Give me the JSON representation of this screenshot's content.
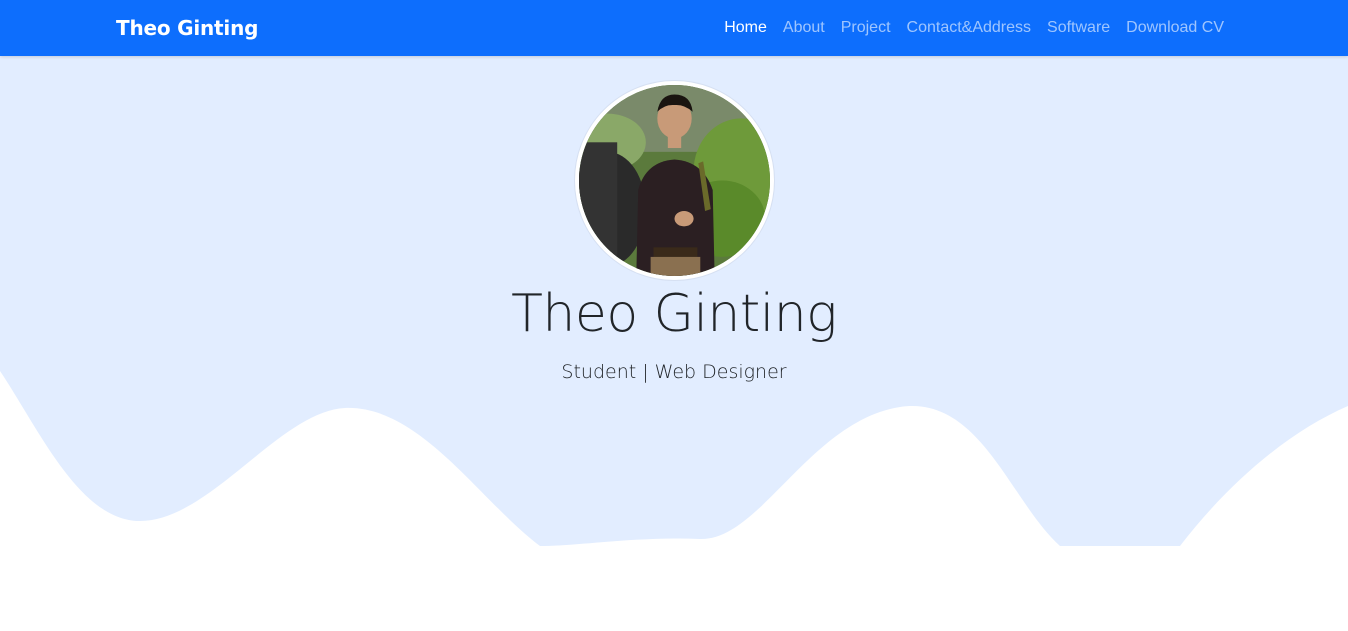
{
  "navbar": {
    "brand": "Theo Ginting",
    "links": [
      {
        "label": "Home",
        "active": true
      },
      {
        "label": "About",
        "active": false
      },
      {
        "label": "Project",
        "active": false
      },
      {
        "label": "Contact&Address",
        "active": false
      },
      {
        "label": "Software",
        "active": false
      },
      {
        "label": "Download CV",
        "active": false
      }
    ]
  },
  "hero": {
    "name": "Theo Ginting",
    "role": "Student | Web Designer"
  },
  "colors": {
    "navbar": "#0d6efd",
    "hero_background": "#e2edff",
    "wave": "#ffffff"
  }
}
